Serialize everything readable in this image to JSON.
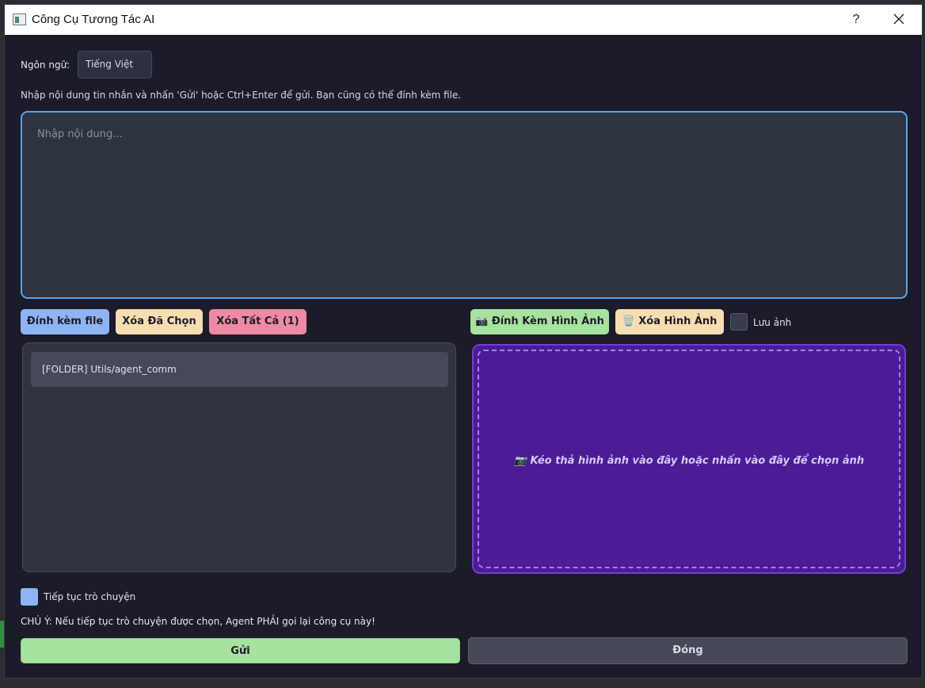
{
  "window": {
    "title": "Công Cụ Tương Tác AI",
    "help_label": "?"
  },
  "language": {
    "label": "Ngôn ngữ:",
    "selected": "Tiếng Việt"
  },
  "instructions": "Nhập nội dung tin nhắn và nhấn 'Gửi' hoặc Ctrl+Enter để gửi. Bạn cũng có thể đính kèm file.",
  "message": {
    "value": "",
    "placeholder": "Nhập nội dung..."
  },
  "file_buttons": {
    "attach": "Đính kèm file",
    "delete_selected": "Xóa Đã Chọn",
    "delete_all": "Xóa Tất Cả (1)"
  },
  "image_buttons": {
    "attach_image": "📷 Đính Kèm Hình Ảnh",
    "delete_image": "🗑️ Xóa Hình Ảnh",
    "save_image_label": "Lưu ảnh"
  },
  "files": [
    "[FOLDER] Utils/agent_comm"
  ],
  "drop_zone": {
    "text": "📷 Kéo thả hình ảnh vào đây hoặc nhấn vào đây để chọn ảnh"
  },
  "continue_chat": {
    "label": "Tiếp tục trò chuyện",
    "checked": true
  },
  "note": "CHÚ Ý: Nếu tiếp tục trò chuyện được chọn, Agent PHẢI gọi lại công cụ này!",
  "actions": {
    "send": "Gửi",
    "close": "Đóng"
  },
  "colors": {
    "background": "#1c1b29",
    "accent_blue": "#8fb4f4",
    "accent_green": "#a6e39f",
    "accent_yellow": "#f7ddb0",
    "accent_pink": "#ee8aa3",
    "drop_zone": "#4a1c96"
  }
}
